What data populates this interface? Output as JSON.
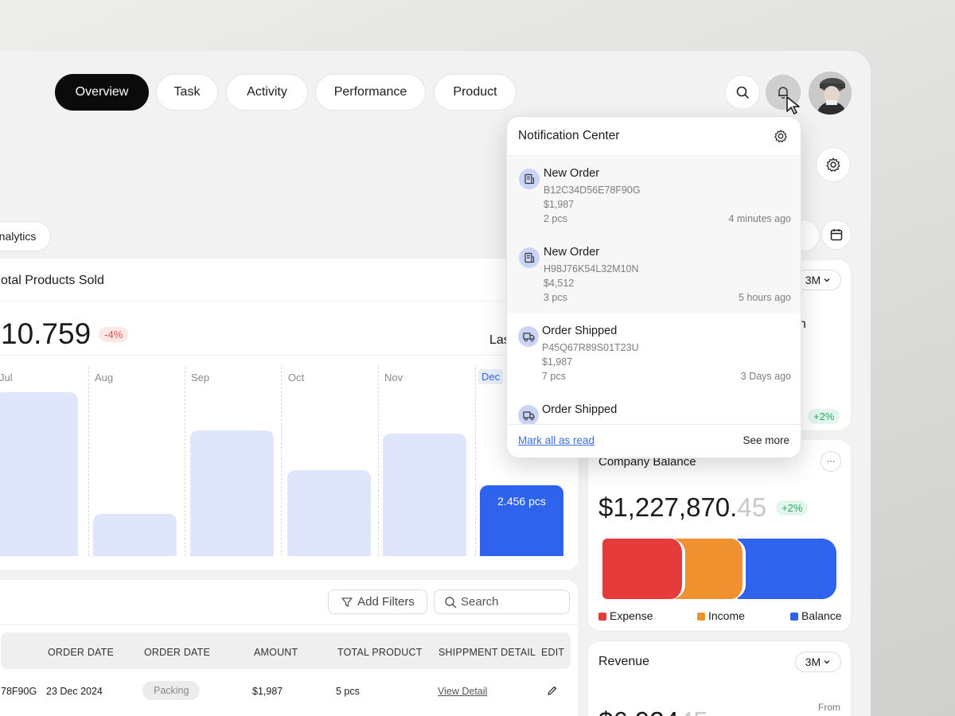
{
  "nav": {
    "tabs": [
      {
        "label": "Overview",
        "active": true
      },
      {
        "label": "Task"
      },
      {
        "label": "Activity"
      },
      {
        "label": "Performance"
      },
      {
        "label": "Product"
      }
    ]
  },
  "header": {
    "icons": [
      "search-icon",
      "bell-icon",
      "avatar",
      "gear-icon",
      "calendar-icon"
    ]
  },
  "analytics_tab": {
    "label": "nalytics"
  },
  "products_card": {
    "title": "otal Products Sold",
    "total": "10.759",
    "change": "-4%",
    "period_label": "Las",
    "months": [
      "Jul",
      "Aug",
      "Sep",
      "Oct",
      "Nov",
      "Dec"
    ],
    "highlight_label": "2.456 pcs"
  },
  "chart_data": {
    "type": "bar",
    "categories": [
      "Jul",
      "Aug",
      "Sep",
      "Oct",
      "Nov",
      "Dec"
    ],
    "values": [
      0.86,
      0.22,
      0.66,
      0.45,
      0.64,
      0.37
    ],
    "highlight": "Dec",
    "highlight_value_label": "2.456 pcs"
  },
  "table": {
    "filters_label": "Add Filters",
    "search_placeholder": "Search",
    "headers": [
      "ORDER DATE",
      "ORDER DATE",
      "AMOUNT",
      "TOTAL PRODUCT",
      "SHIPPMENT DETAIL",
      "EDIT"
    ],
    "rows": [
      {
        "id": "78F90G",
        "date": "23 Dec 2024",
        "status": "Packing",
        "amount": "$1,987",
        "products": "5 pcs",
        "detail": "View Detail"
      }
    ]
  },
  "right_top_card": {
    "period": "3M",
    "change": "+2%",
    "partial_text": "n"
  },
  "balance_card": {
    "title": "Company Balance",
    "amount_main": "$1,227,870.",
    "amount_cents": "45",
    "change": "+2%",
    "legend": [
      {
        "label": "Expense",
        "color": "#e53b3b"
      },
      {
        "label": "Income",
        "color": "#f0912f"
      },
      {
        "label": "Balance",
        "color": "#2f63ee"
      }
    ],
    "more": "···"
  },
  "revenue_card": {
    "title": "Revenue",
    "period": "3M",
    "from_label": "From",
    "amount_partial": "$6,924",
    "cents_partial": "45"
  },
  "notifications": {
    "title": "Notification Center",
    "items": [
      {
        "title": "New Order",
        "code": "B12C34D56E78F90G",
        "amount": "$1,987",
        "qty": "2 pcs",
        "time": "4 minutes ago",
        "icon": "receipt-icon"
      },
      {
        "title": "New Order",
        "code": "H98J76K54L32M10N",
        "amount": "$4,512",
        "qty": "3 pcs",
        "time": "5 hours ago",
        "icon": "receipt-icon"
      },
      {
        "title": "Order Shipped",
        "code": "P45Q67R89S01T23U",
        "amount": "$1,987",
        "qty": "7 pcs",
        "time": "3 Days ago",
        "icon": "truck-icon"
      },
      {
        "title": "Order Shipped",
        "code": "",
        "amount": "",
        "qty": "",
        "time": "",
        "icon": "truck-icon"
      }
    ],
    "mark_all": "Mark all as read",
    "see_more": "See more"
  }
}
